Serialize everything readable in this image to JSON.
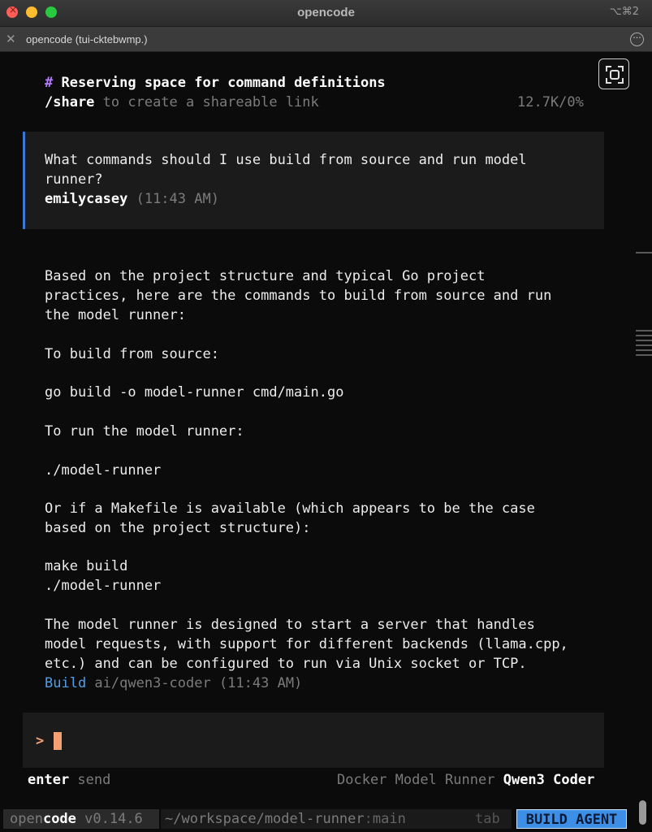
{
  "window": {
    "title": "opencode",
    "shortcut": "⌥⌘2"
  },
  "tab": {
    "title": "opencode (tui-cktebwmp.)"
  },
  "header": {
    "hash": "#",
    "heading": "Reserving space for command definitions",
    "share_cmd": "/share",
    "share_desc": " to create a shareable link",
    "usage": "12.7K/0%"
  },
  "user_message": {
    "lines": [
      "What commands should I use build from source and run model",
      "runner?"
    ],
    "author": "emilycasey",
    "time": " (11:43 AM)"
  },
  "assistant": {
    "lines": [
      "Based on the project structure and typical Go project",
      "practices, here are the commands to build from source and run",
      "the model runner:",
      "",
      "To build from source:",
      "",
      "go build -o model-runner cmd/main.go",
      "",
      "To run the model runner:",
      "",
      "./model-runner",
      "",
      "Or if a Makefile is available (which appears to be the case",
      "based on the project structure):",
      "",
      "make build",
      "./model-runner",
      "",
      "The model runner is designed to start a server that handles",
      "model requests, with support for different backends (llama.cpp,",
      "etc.) and can be configured to run via Unix socket or TCP."
    ],
    "agent": "Build",
    "model_time": " ai/qwen3-coder (11:43 AM)"
  },
  "input": {
    "prompt": ">"
  },
  "hints": {
    "enter_key": "enter",
    "enter_action": " send",
    "provider": "Docker Model Runner",
    "model": "Qwen3 Coder"
  },
  "statusbar": {
    "app_open": "open",
    "app_code": "code",
    "version": " v0.14.6",
    "path": "~/workspace/model-runner",
    "branch_sep": ":",
    "branch": "main",
    "tab_hint": "tab",
    "agent_badge": "BUILD AGENT"
  },
  "colors": {
    "accent": "#3c8ee6",
    "cursor": "#f4a072",
    "purple": "#b57bff"
  }
}
